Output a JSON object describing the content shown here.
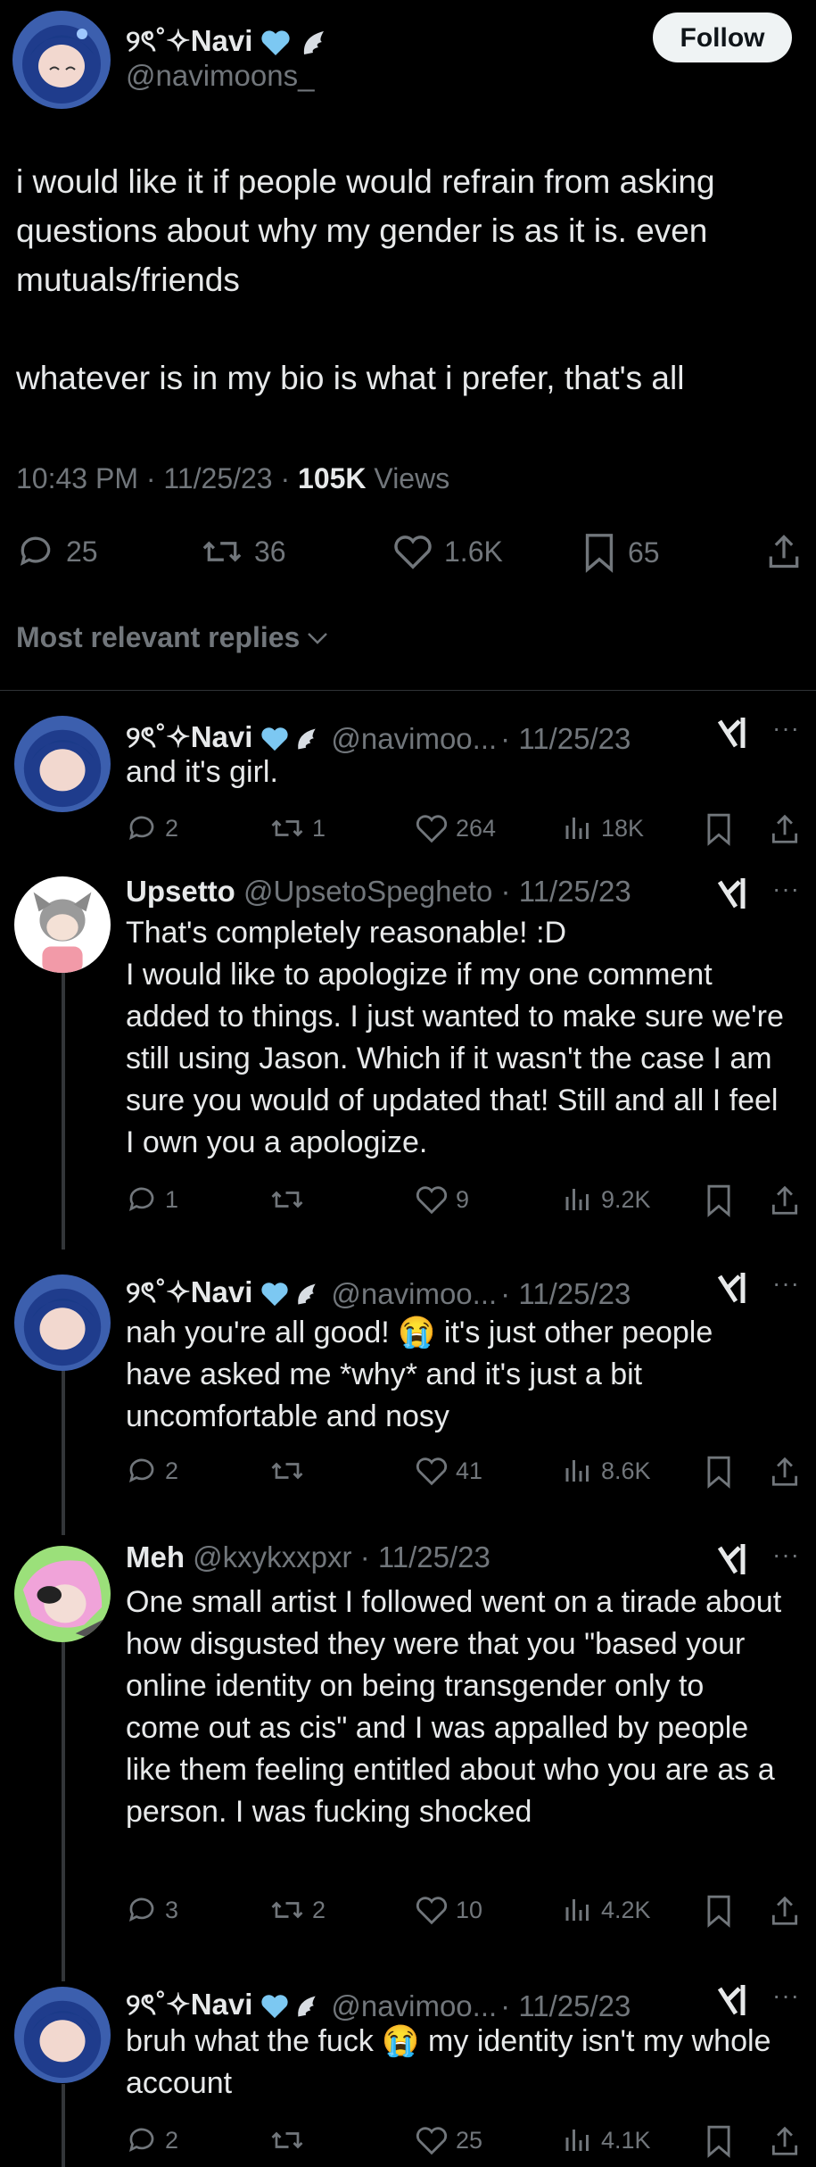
{
  "author": {
    "display_name": "୨ৎ˚✧Navi",
    "handle": "@navimoons_",
    "follow_label": "Follow"
  },
  "tweet": {
    "text": "i would like it if people would refrain from asking questions about why my gender is as it is. even mutuals/friends\n\nwhatever is in my bio is what i prefer, that's all",
    "time": "10:43 PM",
    "date": "11/25/23",
    "views_count": "105K",
    "views_label": "Views",
    "replies": "25",
    "reposts": "36",
    "likes": "1.6K",
    "bookmarks": "65"
  },
  "sort_label": "Most relevant replies",
  "replies": [
    {
      "name": "୨ৎ˚✧Navi",
      "handle": "@navimoo...",
      "date": "· 11/25/23",
      "text": "and it's girl.",
      "replies": "2",
      "reposts": "1",
      "likes": "264",
      "views": "18K"
    },
    {
      "name": "Upsetto",
      "handle": "@UpsetoSpegheto",
      "date": "· 11/25/23",
      "text": "That's completely reasonable! :D\nI would like to apologize if my one comment added to things. I just wanted to make sure we're still using Jason. Which if it wasn't the case I am sure you would of updated that! Still and all I feel I own you a apologize.",
      "replies": "1",
      "reposts": "",
      "likes": "9",
      "views": "9.2K"
    },
    {
      "name": "୨ৎ˚✧Navi",
      "handle": "@navimoo...",
      "date": "· 11/25/23",
      "text": "nah you're all good! 😭 it's just other people have asked me *why* and it's just a bit uncomfortable and nosy",
      "replies": "2",
      "reposts": "",
      "likes": "41",
      "views": "8.6K"
    },
    {
      "name": "Meh",
      "handle": "@kxykxxpxr",
      "date": "· 11/25/23",
      "text": "One small artist I followed went on a tirade about how disgusted they were that you \"based your online identity on being transgender only to come out as cis\" and I was appalled by people like them feeling entitled about who you are as a person. I was fucking shocked",
      "replies": "3",
      "reposts": "2",
      "likes": "10",
      "views": "4.2K"
    },
    {
      "name": "୨ৎ˚✧Navi",
      "handle": "@navimoo...",
      "date": "· 11/25/23",
      "text": "bruh what the fuck 😭 my identity isn't my whole account",
      "replies": "2",
      "reposts": "",
      "likes": "25",
      "views": "4.1K"
    }
  ],
  "colors": {
    "background": "#000000",
    "text": "#e7e9ea",
    "muted": "#71767b",
    "heart_badge": "#7cc8f2"
  },
  "icons": {
    "reply": "speech-bubble-icon",
    "repost": "repost-arrows-icon",
    "like": "heart-icon",
    "views": "bar-chart-icon",
    "bookmark": "bookmark-icon",
    "share": "share-upload-icon",
    "grok": "grok-icon",
    "more": "more-dots-icon"
  }
}
